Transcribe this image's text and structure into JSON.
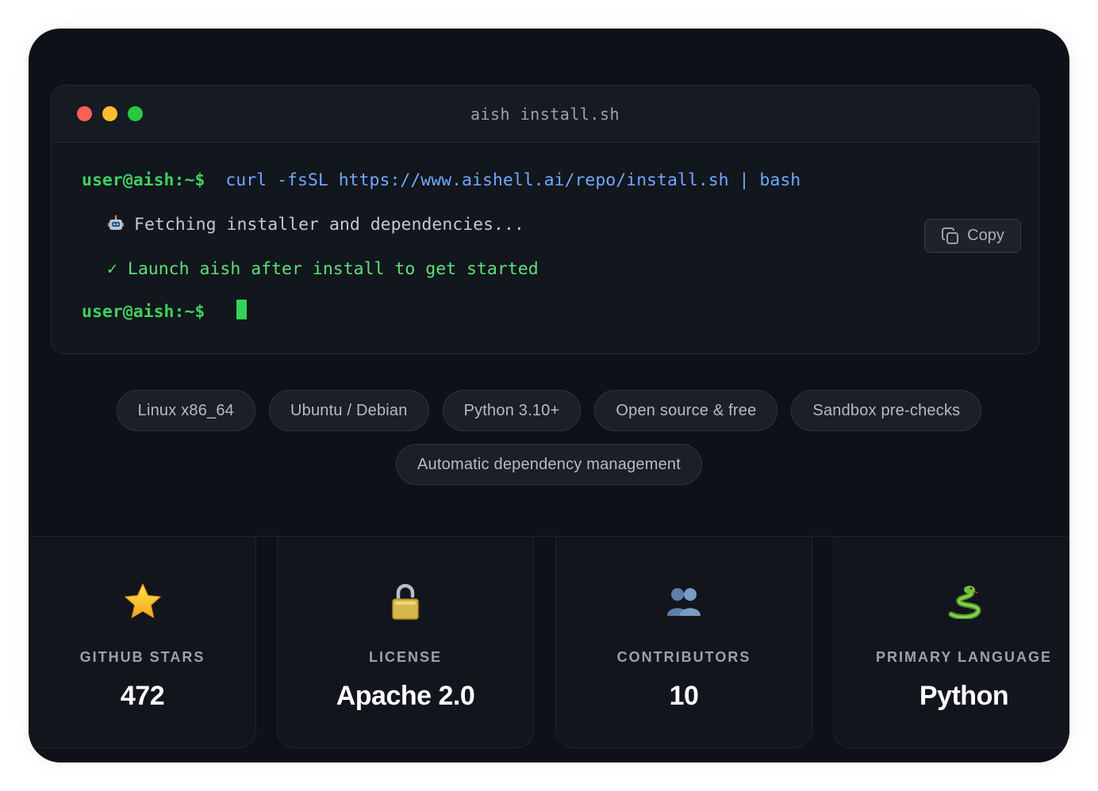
{
  "terminal": {
    "title": "aish install.sh",
    "prompt": "user@aish:~$",
    "command": "curl -fsSL https://www.aishell.ai/repo/install.sh | bash",
    "output_fetch": "Fetching installer and dependencies...",
    "output_fetch_icon": "robot-icon",
    "output_done": "✓ Launch aish after install to get started",
    "prompt2": "user@aish:~$",
    "copy_label": "Copy",
    "colors": {
      "prompt": "#3fcf5e",
      "command": "#6fa8ff",
      "success": "#5fe07a",
      "cursor": "#33d35a"
    }
  },
  "tags_row1": [
    "Linux x86_64",
    "Ubuntu / Debian",
    "Python 3.10+",
    "Open source & free",
    "Sandbox pre-checks"
  ],
  "tags_row2": [
    "Automatic dependency management"
  ],
  "stats": [
    {
      "icon": "star-icon",
      "label": "GITHUB STARS",
      "value": "472"
    },
    {
      "icon": "lock-icon",
      "label": "LICENSE",
      "value": "Apache 2.0"
    },
    {
      "icon": "people-icon",
      "label": "CONTRIBUTORS",
      "value": "10"
    },
    {
      "icon": "snake-icon",
      "label": "PRIMARY LANGUAGE",
      "value": "Python"
    }
  ]
}
